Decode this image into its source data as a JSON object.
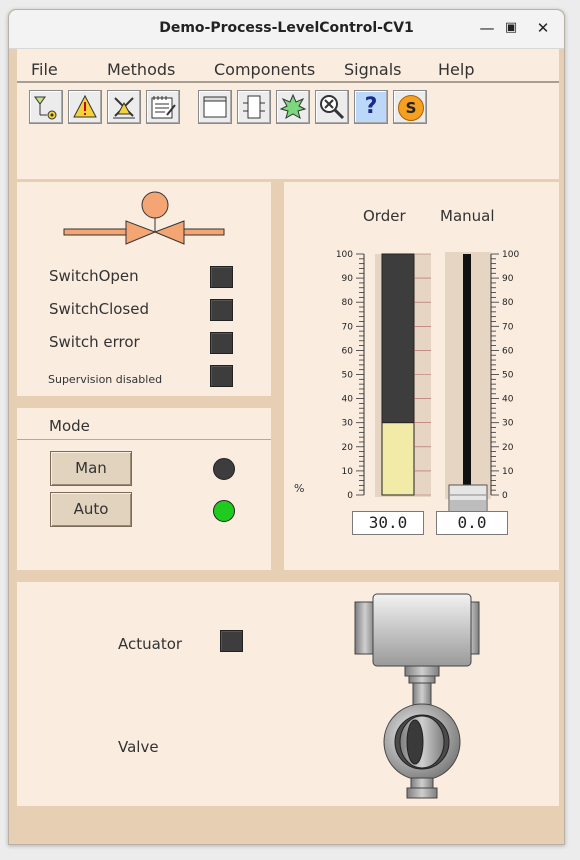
{
  "window": {
    "title": "Demo-Process-LevelControl-CV1"
  },
  "menu": [
    "File",
    "Methods",
    "Components",
    "Signals",
    "Help"
  ],
  "toolbar": [
    {
      "icon": "object-graph-icon"
    },
    {
      "icon": "alarm-warning-icon"
    },
    {
      "icon": "block-event-icon"
    },
    {
      "icon": "trend-notes-icon"
    },
    {
      "icon": "open-object-icon"
    },
    {
      "icon": "object-module-icon"
    },
    {
      "icon": "crossreference-icon"
    },
    {
      "icon": "zoom-object-icon"
    },
    {
      "icon": "help-icon"
    },
    {
      "icon": "signals-s-icon"
    }
  ],
  "toolbar_glyphs": {
    "help": "?",
    "signals": "S"
  },
  "switch": {
    "labels": {
      "open": "SwitchOpen",
      "closed": "SwitchClosed",
      "error": "Switch error",
      "supervision": "Supervision disabled"
    }
  },
  "mode": {
    "title": "Mode",
    "man_label": "Man",
    "auto_label": "Auto",
    "man_lamp_color": "#3d3d3d",
    "auto_lamp_color": "#1ecb1e"
  },
  "bars": {
    "order_label": "Order",
    "manual_label": "Manual",
    "unit": "%",
    "scale_ticks": [
      "100",
      "90",
      "80",
      "70",
      "60",
      "50",
      "40",
      "30",
      "20",
      "10",
      "0"
    ],
    "order_value": "30.0",
    "manual_value": "0.0",
    "order_fraction": 0.3,
    "manual_fraction": 0.0,
    "fill_color": "#f2eba8",
    "empty_color": "#3d3d3d"
  },
  "process": {
    "actuator_label": "Actuator",
    "valve_label": "Valve"
  },
  "colors": {
    "window_bg": "#e7cfb4",
    "panel_bg": "#fbece0",
    "valve_orange": "#f4a574"
  }
}
